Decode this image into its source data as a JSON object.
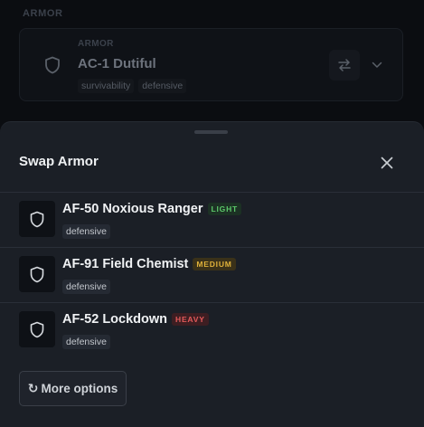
{
  "background": {
    "section_label": "ARMOR",
    "equipped": {
      "category": "ARMOR",
      "name": "AC-1 Dutiful",
      "tags": [
        "survivability",
        "defensive"
      ],
      "icon": "shield-icon",
      "swap_icon": "swap-arrows-icon",
      "expand_icon": "chevron-down-icon"
    }
  },
  "sheet": {
    "title": "Swap Armor",
    "close_icon": "close-icon",
    "options": [
      {
        "name": "AF-50 Noxious Ranger",
        "weight": "LIGHT",
        "weight_class": "light",
        "tag": "defensive",
        "icon": "shield-icon"
      },
      {
        "name": "AF-91 Field Chemist",
        "weight": "MEDIUM",
        "weight_class": "medium",
        "tag": "defensive",
        "icon": "shield-icon"
      },
      {
        "name": "AF-52 Lockdown",
        "weight": "HEAVY",
        "weight_class": "heavy",
        "tag": "defensive",
        "icon": "shield-icon"
      }
    ],
    "more_button": {
      "icon": "↻",
      "label": "More options"
    }
  },
  "colors": {
    "sheet_bg": "#1b1f26",
    "page_bg": "#0b0d11",
    "light": "#5cc86a",
    "medium": "#e0b23a",
    "heavy": "#e45a5a"
  }
}
